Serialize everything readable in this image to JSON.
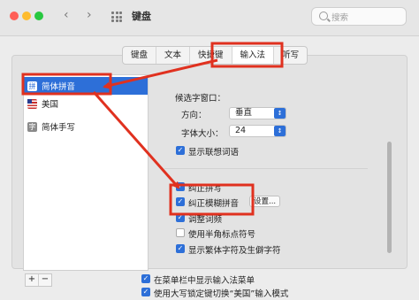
{
  "window": {
    "title": "键盘",
    "search_placeholder": "搜索"
  },
  "toolbar": {
    "back_icon": "chevron-left-icon",
    "forward_icon": "chevron-right-icon",
    "grid_icon": "grid-icon"
  },
  "traffic_lights": {
    "close": "#ff5f57",
    "minimize": "#febc2e",
    "zoom": "#28c840"
  },
  "tabs": [
    {
      "label": "键盘",
      "active": false
    },
    {
      "label": "文本",
      "active": false
    },
    {
      "label": "快捷键",
      "active": false
    },
    {
      "label": "输入法",
      "active": true
    },
    {
      "label": "听写",
      "active": false
    }
  ],
  "sidebar": {
    "items": [
      {
        "label": "简体拼音",
        "icon": "拼",
        "selected": true
      },
      {
        "label": "美国",
        "icon": "flag",
        "selected": false
      },
      {
        "label": "简体手写",
        "icon": "字",
        "selected": false
      }
    ],
    "add_label": "+",
    "remove_label": "−"
  },
  "settings": {
    "candidate_window_label": "候选字窗口：",
    "direction_label": "方向：",
    "direction_value": "垂直",
    "font_size_label": "字体大小：",
    "font_size_value": "24",
    "show_predictions": {
      "label": "显示联想词语",
      "checked": true
    },
    "autocorrect": {
      "label": "纠正拼写",
      "checked": true
    },
    "fuzzy_pinyin": {
      "label": "纠正模糊拼音",
      "checked": true
    },
    "fuzzy_settings_button": "设置...",
    "adjust_frequency": {
      "label": "调整词频",
      "checked": true
    },
    "half_width_punct": {
      "label": "使用半角标点符号",
      "checked": false
    },
    "show_traditional": {
      "label": "显示繁体字符及生僻字符",
      "checked": true
    }
  },
  "bottom": {
    "show_menu": {
      "label": "在菜单栏中显示输入法菜单",
      "checked": true
    },
    "caps_lock_switch": {
      "label": "使用大写锁定键切换“美国”输入模式",
      "checked": true
    }
  },
  "colors": {
    "accent": "#2d6fd8",
    "annotation": "#e0311f"
  }
}
